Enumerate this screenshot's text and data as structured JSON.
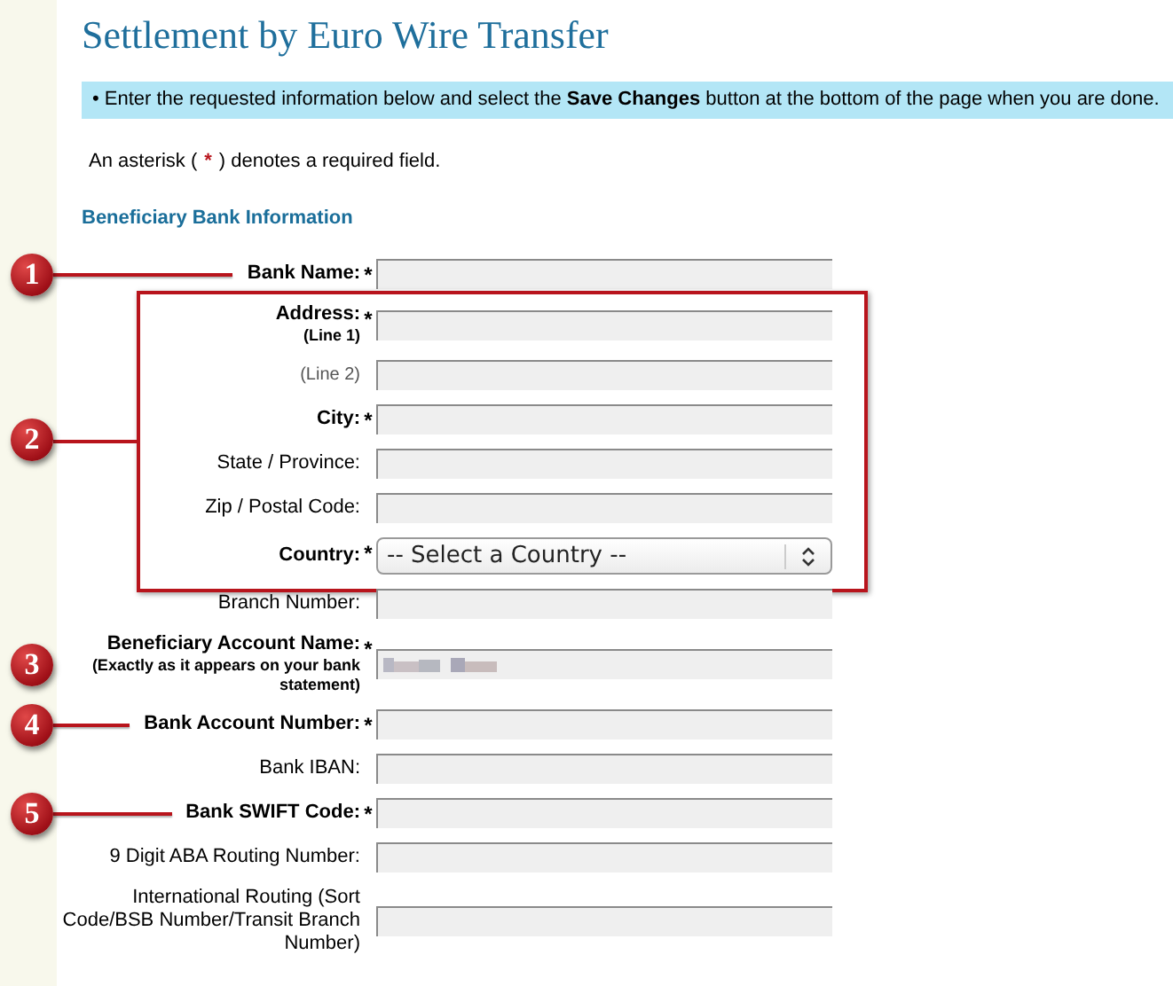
{
  "title": "Settlement by Euro Wire Transfer",
  "info_bar": {
    "bullet": "•",
    "text": "Enter the requested information below and select the **Save Changes** button at the bottom of the page when you are done."
  },
  "required_note": {
    "before": "An asterisk (",
    "mark": "*",
    "after": ")  denotes a required field."
  },
  "section_title": "Beneficiary Bank Information",
  "form": [
    {
      "kind": "text",
      "label": "Bank Name:",
      "required": true,
      "asterisk": "*",
      "callout": "1"
    },
    {
      "kind": "group",
      "callout": "2",
      "fields": [
        {
          "kind": "text",
          "label": "Address:",
          "note": "(Line 1)",
          "required": true,
          "asterisk": "*"
        },
        {
          "kind": "text",
          "label": "(Line 2)",
          "required": false,
          "muted": true
        },
        {
          "kind": "text",
          "label": "City:",
          "required": true,
          "asterisk": "*"
        },
        {
          "kind": "text",
          "label": "State / Province:",
          "required": false
        },
        {
          "kind": "text",
          "label": "Zip / Postal Code:",
          "required": false
        },
        {
          "kind": "select",
          "label": "Country:",
          "required": true,
          "asterisk": "*",
          "value": "-- Select a Country --"
        }
      ]
    },
    {
      "kind": "text",
      "label": "Branch Number:",
      "required": false
    },
    {
      "kind": "text",
      "label": "Beneficiary Account Name:",
      "note": "(Exactly as it appears on your bank statement)",
      "required": true,
      "asterisk": "*",
      "redacted": true,
      "callout": "3"
    },
    {
      "kind": "text",
      "label": "Bank Account Number:",
      "required": true,
      "asterisk": "*",
      "callout": "4"
    },
    {
      "kind": "text",
      "label": "Bank IBAN:",
      "required": false
    },
    {
      "kind": "text",
      "label": "Bank SWIFT Code:",
      "required": true,
      "asterisk": "*",
      "callout": "5"
    },
    {
      "kind": "text",
      "label": "9 Digit ABA Routing Number:",
      "required": false
    },
    {
      "kind": "text",
      "label": "International Routing (Sort Code/BSB Number/Transit Branch Number)",
      "required": false
    }
  ]
}
